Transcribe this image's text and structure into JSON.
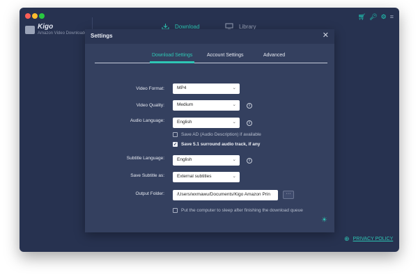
{
  "app": {
    "name": "Kigo",
    "subtitle": "Amazon Video Downloader",
    "accent_color": "#2ec6b4",
    "background_color": "#273250"
  },
  "nav": {
    "download_label": "Download",
    "library_label": "Library"
  },
  "toolbar_icons": [
    "cart-icon",
    "key-icon",
    "gear-icon",
    "menu-icon"
  ],
  "footer": {
    "privacy_label": "PRIVACY POLICY"
  },
  "dialog": {
    "title": "Settings",
    "close_glyph": "✕",
    "tabs": [
      {
        "label": "Download Settings",
        "active": true
      },
      {
        "label": "Account Settings",
        "active": false
      },
      {
        "label": "Advanced",
        "active": false
      }
    ],
    "fields": {
      "video_format": {
        "label": "Video Format:",
        "value": "MP4"
      },
      "video_quality": {
        "label": "Video Quality:",
        "value": "Medium"
      },
      "audio_language": {
        "label": "Audio Language:",
        "value": "English"
      },
      "subtitle_language": {
        "label": "Subtitle Language:",
        "value": "English"
      },
      "save_subtitle": {
        "label": "Save Subtitle as:",
        "value": "External subtitles"
      },
      "output_folder": {
        "label": "Output Folder:",
        "value": "/Users/wxmawu/Documents/Kigo Amazon Prin",
        "browse_label": "···"
      }
    },
    "checkboxes": {
      "save_ad": {
        "label": "Save AD (Audio Description) if available",
        "checked": false
      },
      "save_51": {
        "label": "Save 5.1 surround audio track, if any",
        "checked": true
      },
      "sleep": {
        "label": "Put the computer to sleep after finishing the download queue",
        "checked": false
      }
    }
  }
}
